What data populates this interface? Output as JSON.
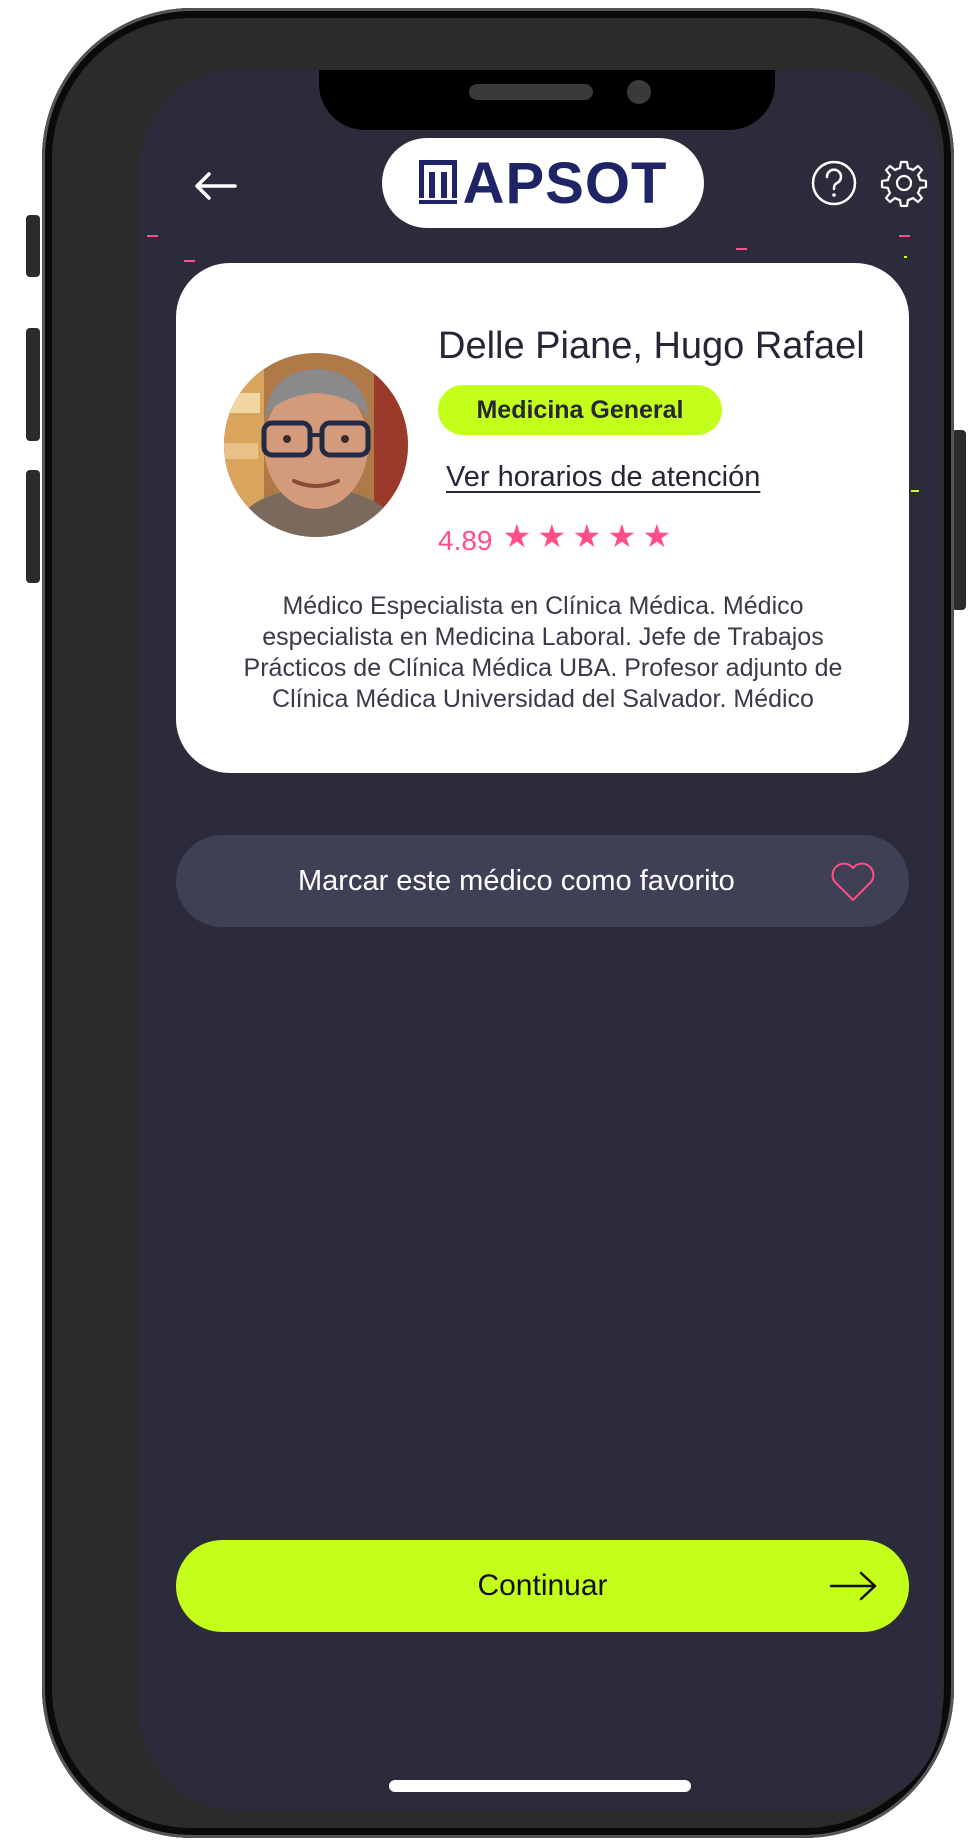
{
  "header": {
    "logo_text": "APSOT",
    "logo_mark": "TECHINT",
    "icons": [
      "back-arrow-icon",
      "help-icon",
      "gear-icon"
    ]
  },
  "doctor": {
    "name": "Delle Piane, Hugo Rafael",
    "specialty": "Medicina General",
    "schedule_link": "Ver horarios de atención",
    "rating": "4.89",
    "stars": 5,
    "bio": "Médico Especialista en Clínica Médica. Médico especialista en Medicina Laboral. Jefe de Trabajos Prácticos de Clínica Médica UBA. Profesor adjunto de Clínica Médica Universidad del Salvador. Médico"
  },
  "favorite": {
    "label": "Marcar este médico como favorito",
    "icon": "heart-icon"
  },
  "footer": {
    "continue_label": "Continuar",
    "icon": "arrow-right-icon"
  },
  "colors": {
    "background": "#2c2b3c",
    "accent": "#c3ff1a",
    "rating": "#ff4f86",
    "card": "#ffffff",
    "favorite_bg": "#3f3f56"
  }
}
